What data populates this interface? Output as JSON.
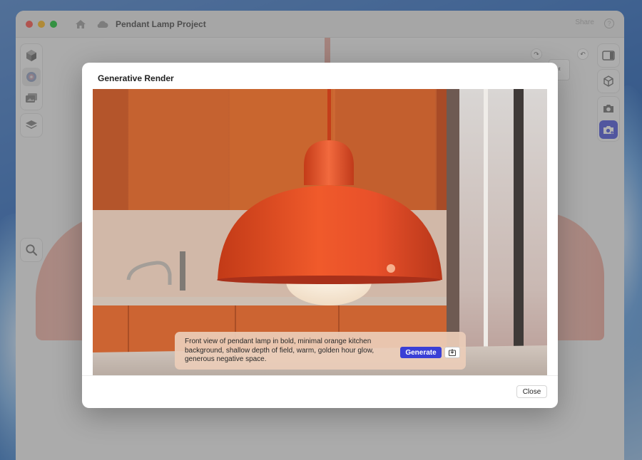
{
  "window": {
    "title": "Pendant Lamp Project",
    "share_label": "Share",
    "help_label": "?"
  },
  "canvas": {
    "mini_card_text": "ont"
  },
  "icons": {
    "home": "home-icon",
    "cloud": "cloud-icon",
    "cube": "cube-icon",
    "material": "material-icon",
    "image": "image-icon",
    "layers": "layers-icon",
    "search": "search-icon",
    "panel": "panel-icon",
    "view": "view-icon",
    "camera": "camera-icon",
    "render_camera": "render-camera-icon",
    "redo": "redo-icon",
    "undo": "undo-icon",
    "save": "save-icon"
  },
  "modal": {
    "title": "Generative Render",
    "prompt": "Front view of pendant lamp in bold, minimal orange kitchen background, shallow depth of field, warm, golden hour glow, generous negative space.",
    "generate_label": "Generate",
    "close_label": "Close"
  },
  "colors": {
    "accent": "#3a3fd6",
    "lamp": "#e2461f",
    "kitchen": "#c76030"
  }
}
